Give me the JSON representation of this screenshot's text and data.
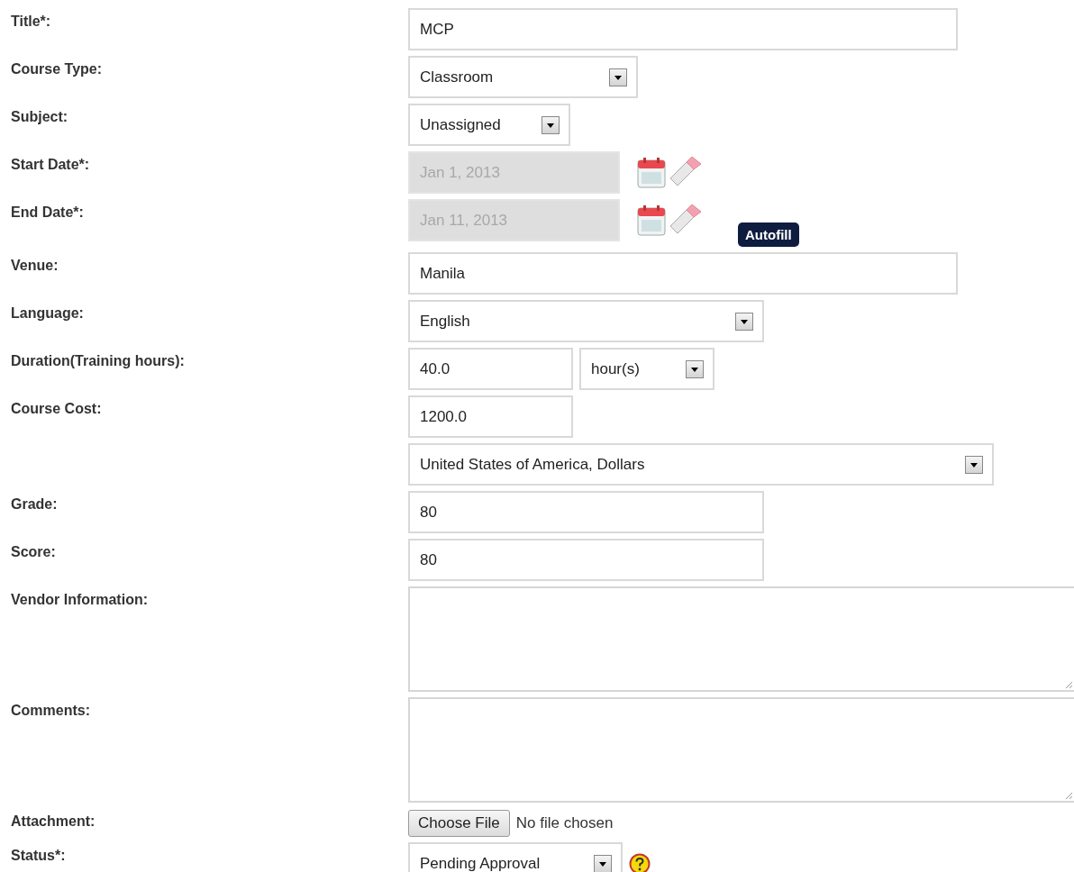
{
  "fields": [
    {
      "kind": "text",
      "label": "Title*:",
      "value": "MCP"
    },
    {
      "kind": "select",
      "label": "Course Type:",
      "value": "Classroom"
    },
    {
      "kind": "select",
      "label": "Subject:",
      "value": "Unassigned"
    },
    {
      "kind": "date",
      "label": "Start Date*:",
      "value": "Jan 1, 2013",
      "disabled": true
    },
    {
      "kind": "date",
      "label": "End Date*:",
      "value": "Jan 11, 2013",
      "disabled": true,
      "tooltip": "Autofill"
    },
    {
      "kind": "text",
      "label": "Venue:",
      "value": "Manila"
    },
    {
      "kind": "select",
      "label": "Language:",
      "value": "English"
    },
    {
      "kind": "duration",
      "label": "Duration(Training hours):",
      "value": "40.0",
      "unit": "hour(s)"
    },
    {
      "kind": "text",
      "label": "Course Cost:",
      "value": "1200.0"
    },
    {
      "kind": "select",
      "value": "United States of America, Dollars"
    },
    {
      "kind": "text",
      "label": "Grade:",
      "value": "80"
    },
    {
      "kind": "text",
      "label": "Score:",
      "value": "80"
    },
    {
      "kind": "textarea",
      "label": "Vendor Information:"
    },
    {
      "kind": "textarea",
      "label": "Comments:"
    },
    {
      "kind": "file",
      "label": "Attachment:",
      "button": "Choose File",
      "status": "No file chosen"
    },
    {
      "kind": "status",
      "label": "Status*:",
      "value": "Pending Approval"
    }
  ]
}
